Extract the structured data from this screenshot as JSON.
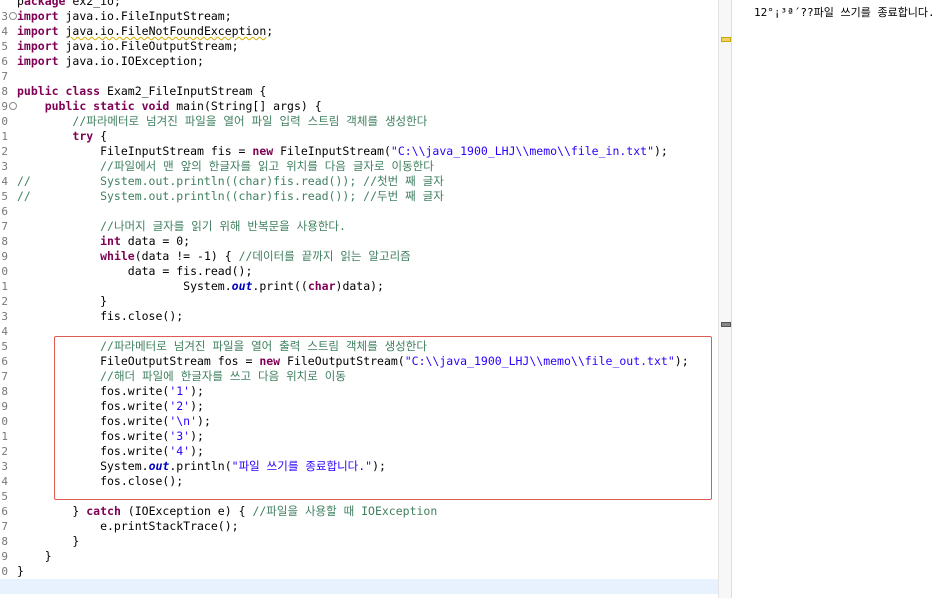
{
  "editor": {
    "lines": [
      {
        "n": "",
        "fold": "",
        "segs": [
          [
            "t",
            "p"
          ],
          [
            "k",
            "ackage"
          ],
          [
            "t",
            " ex2_io;"
          ]
        ]
      },
      {
        "n": "3",
        "fold": "⊖",
        "segs": [
          [
            "k",
            "import"
          ],
          [
            "t",
            " java.io.FileInputStream;"
          ]
        ]
      },
      {
        "n": "4",
        "fold": "",
        "segs": [
          [
            "k",
            "import"
          ],
          [
            "t",
            " "
          ],
          [
            "w",
            "java.io.FileNotFoundException"
          ],
          [
            "t",
            ";"
          ]
        ]
      },
      {
        "n": "5",
        "fold": "",
        "segs": [
          [
            "k",
            "import"
          ],
          [
            "t",
            " java.io.FileOutputStream;"
          ]
        ]
      },
      {
        "n": "6",
        "fold": "",
        "segs": [
          [
            "k",
            "import"
          ],
          [
            "t",
            " java.io.IOException;"
          ]
        ]
      },
      {
        "n": "7",
        "fold": "",
        "segs": []
      },
      {
        "n": "8",
        "fold": "",
        "segs": [
          [
            "k",
            "public class"
          ],
          [
            "t",
            " Exam2_FileInputStream {"
          ]
        ]
      },
      {
        "n": "9",
        "fold": "⊖",
        "segs": [
          [
            "t",
            "    "
          ],
          [
            "k",
            "public static void"
          ],
          [
            "t",
            " main(String[] args) {"
          ]
        ]
      },
      {
        "n": "0",
        "fold": "",
        "segs": [
          [
            "t",
            "        "
          ],
          [
            "c",
            "//파라메터로 넘겨진 파일을 열어 파일 입력 스트림 객체를 생성한다"
          ]
        ]
      },
      {
        "n": "1",
        "fold": "",
        "segs": [
          [
            "t",
            "        "
          ],
          [
            "k",
            "try"
          ],
          [
            "t",
            " {"
          ]
        ]
      },
      {
        "n": "2",
        "fold": "",
        "segs": [
          [
            "t",
            "            FileInputStream fis = "
          ],
          [
            "k",
            "new"
          ],
          [
            "t",
            " FileInputStream("
          ],
          [
            "s",
            "\"C:\\\\java_1900_LHJ\\\\memo\\\\file_in.txt\""
          ],
          [
            "t",
            ");"
          ]
        ]
      },
      {
        "n": "3",
        "fold": "",
        "segs": [
          [
            "t",
            "            "
          ],
          [
            "c",
            "//파일에서 맨 앞의 한글자를 읽고 위치를 다음 글자로 이동한다"
          ]
        ]
      },
      {
        "n": "4",
        "fold": "",
        "segs": [
          [
            "c",
            "//          System.out.println((char)fis.read()); //첫번 째 글자"
          ]
        ]
      },
      {
        "n": "5",
        "fold": "",
        "segs": [
          [
            "c",
            "//          System.out.println((char)fis.read()); //두번 째 글자"
          ]
        ]
      },
      {
        "n": "6",
        "fold": "",
        "segs": []
      },
      {
        "n": "7",
        "fold": "",
        "segs": [
          [
            "t",
            "            "
          ],
          [
            "c",
            "//나머지 글자를 읽기 위해 반복문을 사용한다."
          ]
        ]
      },
      {
        "n": "8",
        "fold": "",
        "segs": [
          [
            "t",
            "            "
          ],
          [
            "k",
            "int"
          ],
          [
            "t",
            " data = 0;"
          ]
        ]
      },
      {
        "n": "9",
        "fold": "",
        "segs": [
          [
            "t",
            "            "
          ],
          [
            "k",
            "while"
          ],
          [
            "t",
            "(data != -1) { "
          ],
          [
            "c",
            "//데이터를 끝까지 읽는 알고리즘"
          ]
        ]
      },
      {
        "n": "0",
        "fold": "",
        "segs": [
          [
            "t",
            "                data = fis.read();"
          ]
        ]
      },
      {
        "n": "1",
        "fold": "",
        "segs": [
          [
            "t",
            "                        System."
          ],
          [
            "i",
            "out"
          ],
          [
            "t",
            ".print(("
          ],
          [
            "k",
            "char"
          ],
          [
            "t",
            ")data);"
          ]
        ]
      },
      {
        "n": "2",
        "fold": "",
        "segs": [
          [
            "t",
            "            }"
          ]
        ]
      },
      {
        "n": "3",
        "fold": "",
        "segs": [
          [
            "t",
            "            fis.close();"
          ]
        ]
      },
      {
        "n": "4",
        "fold": "",
        "segs": []
      },
      {
        "n": "5",
        "fold": "",
        "segs": [
          [
            "t",
            "            "
          ],
          [
            "c",
            "//파라메터로 넘겨진 파일을 열어 출력 스트림 객체를 생성한다"
          ]
        ]
      },
      {
        "n": "6",
        "fold": "",
        "segs": [
          [
            "t",
            "            FileOutputStream fos = "
          ],
          [
            "k",
            "new"
          ],
          [
            "t",
            " FileOutputStream("
          ],
          [
            "s",
            "\"C:\\\\java_1900_LHJ\\\\memo\\\\file_out.txt\""
          ],
          [
            "t",
            ");"
          ]
        ]
      },
      {
        "n": "7",
        "fold": "",
        "segs": [
          [
            "t",
            "            "
          ],
          [
            "c",
            "//해더 파일에 한글자를 쓰고 다음 위치로 이동"
          ]
        ]
      },
      {
        "n": "8",
        "fold": "",
        "segs": [
          [
            "t",
            "            fos.write("
          ],
          [
            "s",
            "'1'"
          ],
          [
            "t",
            ");"
          ]
        ]
      },
      {
        "n": "9",
        "fold": "",
        "segs": [
          [
            "t",
            "            fos.write("
          ],
          [
            "s",
            "'2'"
          ],
          [
            "t",
            ");"
          ]
        ]
      },
      {
        "n": "0",
        "fold": "",
        "segs": [
          [
            "t",
            "            fos.write("
          ],
          [
            "s",
            "'\\n'"
          ],
          [
            "t",
            ");"
          ]
        ]
      },
      {
        "n": "1",
        "fold": "",
        "segs": [
          [
            "t",
            "            fos.write("
          ],
          [
            "s",
            "'3'"
          ],
          [
            "t",
            ");"
          ]
        ]
      },
      {
        "n": "2",
        "fold": "",
        "segs": [
          [
            "t",
            "            fos.write("
          ],
          [
            "s",
            "'4'"
          ],
          [
            "t",
            ");"
          ]
        ]
      },
      {
        "n": "3",
        "fold": "",
        "segs": [
          [
            "t",
            "            System."
          ],
          [
            "i",
            "out"
          ],
          [
            "t",
            ".println("
          ],
          [
            "s",
            "\"파일 쓰기를 종료합니다.\""
          ],
          [
            "t",
            ");"
          ]
        ]
      },
      {
        "n": "4",
        "fold": "",
        "segs": [
          [
            "t",
            "            fos.close();"
          ]
        ]
      },
      {
        "n": "5",
        "fold": "",
        "segs": []
      },
      {
        "n": "6",
        "fold": "",
        "segs": [
          [
            "t",
            "        } "
          ],
          [
            "k",
            "catch"
          ],
          [
            "t",
            " (IOException e) { "
          ],
          [
            "c",
            "//파일을 사용할 때 IOException"
          ]
        ]
      },
      {
        "n": "7",
        "fold": "",
        "segs": [
          [
            "t",
            "            e.printStackTrace();"
          ]
        ]
      },
      {
        "n": "8",
        "fold": "",
        "segs": [
          [
            "t",
            "        }"
          ]
        ]
      },
      {
        "n": "9",
        "fold": "",
        "segs": [
          [
            "t",
            "    }"
          ]
        ]
      },
      {
        "n": "0",
        "fold": "",
        "segs": [
          [
            "t",
            "}"
          ]
        ]
      },
      {
        "n": "",
        "fold": "",
        "segs": [],
        "current": true
      }
    ]
  },
  "colors": {
    "keyword": "#7f0055",
    "string": "#2a00ff",
    "comment": "#3f7f5f",
    "field": "#0000c0",
    "highlight_box": "#e05a55",
    "current_line": "#e8f2fe",
    "ruler_warning": "#f0d060",
    "ruler_marker": "#888888"
  },
  "console": {
    "output": "12°¡³ª´??파일 쓰기를 종료합니다."
  }
}
